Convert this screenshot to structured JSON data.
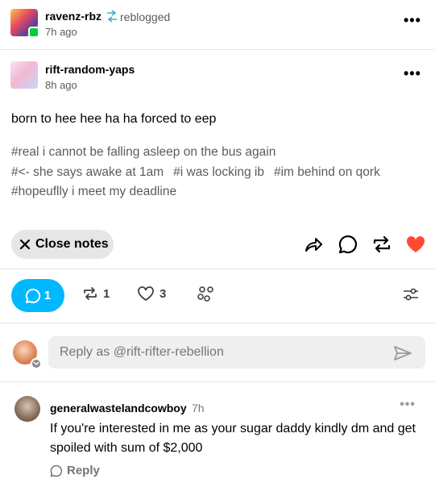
{
  "reblog_header": {
    "username": "ravenz-rbz",
    "action": "reblogged",
    "time": "7h ago"
  },
  "original_post": {
    "username": "rift-random-yaps",
    "time": "8h ago",
    "body": "born to hee hee ha ha forced to eep",
    "tags": [
      "#real i cannot be falling asleep on the bus again",
      "#<- she says awake at 1am",
      "#i was locking ib",
      "#im behind on qork",
      "#hopeuflly i meet my deadline"
    ]
  },
  "actions": {
    "close_notes_label": "Close notes",
    "like_color": "#ff4930"
  },
  "notes_tabs": {
    "replies_count": "1",
    "reblogs_count": "1",
    "likes_count": "3",
    "active_color": "#00b8ff"
  },
  "reply_box": {
    "placeholder": "Reply as @rift-rifter-rebellion"
  },
  "notes": [
    {
      "username": "generalwastelandcowboy",
      "time": "7h",
      "text": "If you're interested in me as your sugar daddy kindly dm and get spoiled with sum of $2,000",
      "reply_label": "Reply"
    }
  ],
  "icons": {
    "more": "more-horizontal-icon",
    "share": "share-arrow-icon",
    "reply": "speech-bubble-icon",
    "reblog": "reblog-icon",
    "like": "heart-icon",
    "filter": "sliders-icon",
    "send": "send-icon",
    "community": "community-icon",
    "close": "close-icon"
  }
}
